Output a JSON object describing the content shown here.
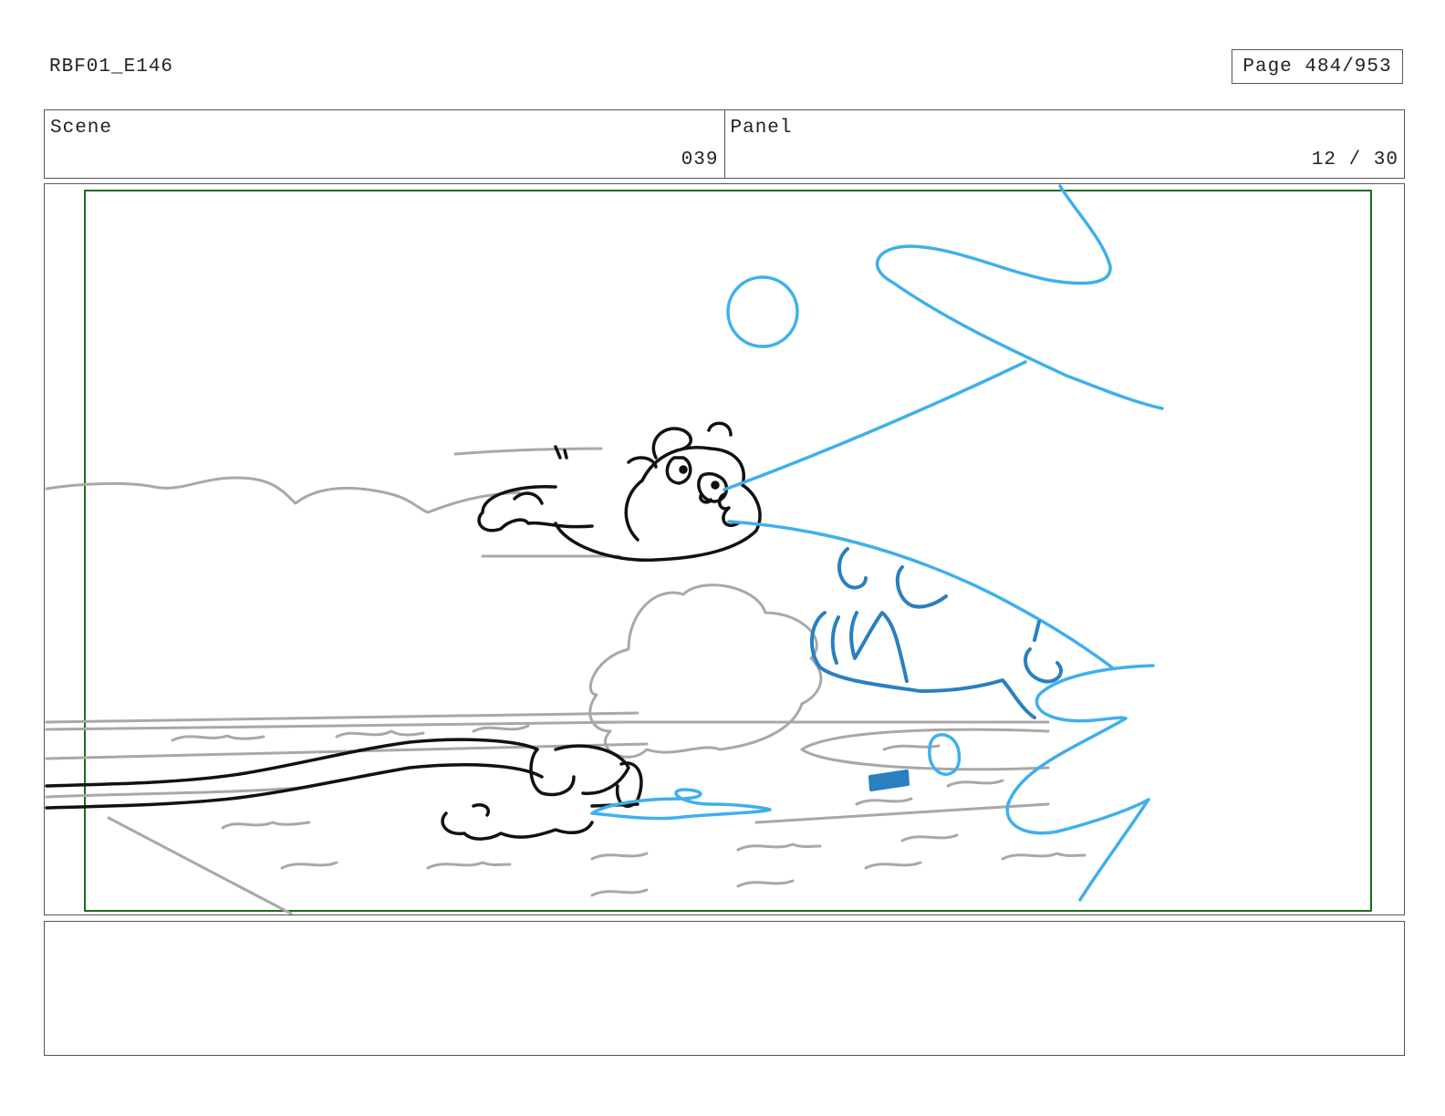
{
  "document": {
    "id": "RBF01_E146",
    "page_label": "Page 484/953"
  },
  "header": {
    "scene_label": "Scene",
    "scene_value": "039",
    "panel_label": "Panel",
    "panel_value": "12 / 30"
  },
  "notes": {
    "text": ""
  },
  "colors": {
    "safe_frame": "#1e6b1e",
    "sketch_black": "#111111",
    "sketch_gray": "#a8a8a8",
    "sketch_blue": "#3fb0ea",
    "sketch_dark_blue": "#2a7fbf"
  }
}
